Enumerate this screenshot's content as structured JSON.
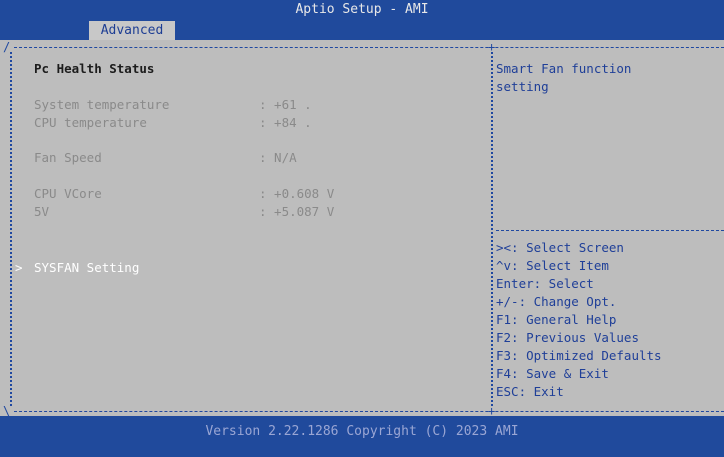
{
  "window": {
    "title": "Aptio Setup - AMI",
    "active_tab": "Advanced"
  },
  "content": {
    "section_title": "Pc Health Status",
    "rows": [
      {
        "label": "System temperature",
        "value": ": +61 ."
      },
      {
        "label": "CPU temperature",
        "value": ": +84 ."
      },
      {
        "label": "Fan Speed",
        "value": ": N/A"
      },
      {
        "label": "CPU VCore",
        "value": ": +0.608 V"
      },
      {
        "label": "5V",
        "value": ": +5.087 V"
      }
    ],
    "submenu": {
      "marker": ">",
      "label": "SYSFAN Setting"
    }
  },
  "help": {
    "description": [
      "Smart Fan function",
      "setting"
    ],
    "keys": [
      "><: Select Screen",
      "^v: Select Item",
      "Enter: Select",
      "+/-: Change Opt.",
      "F1: General Help",
      "F2: Previous Values",
      "F3: Optimized Defaults",
      "F4: Save & Exit",
      "ESC: Exit"
    ]
  },
  "footer": "Version 2.22.1286 Copyright (C) 2023 AMI",
  "colors": {
    "frame_blue": "#204a9c",
    "panel_gray": "#bdbdbd",
    "help_text_blue": "#1f3f98"
  }
}
